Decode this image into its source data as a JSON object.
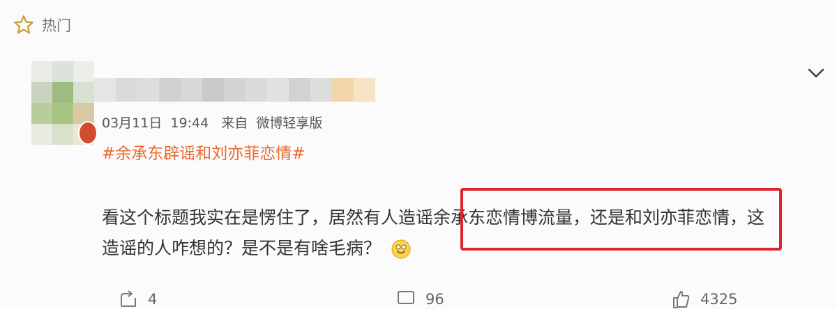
{
  "header": {
    "hot_label": "热门"
  },
  "post": {
    "meta": "03月11日  19:44   来自  微博轻享版",
    "hashtag": "#余承东辟谣和刘亦菲恋情#",
    "text_part1": "看这个标题我实在是愣住了，居然有人造谣余承东恋情博流量，还是和刘亦菲恋情，这",
    "text_part2": "造谣的人咋想的？是不是有啥毛病？"
  },
  "actions": {
    "forward_count": "4",
    "comment_count": "96",
    "like_count": "4325"
  },
  "colors": {
    "hashtag": "#e8692e",
    "highlight_border": "#e0242d",
    "star_stroke": "#c89b32"
  },
  "icons": [
    "star-icon",
    "chevron-down-icon",
    "forward-icon",
    "comment-icon",
    "like-icon",
    "smile-emoji"
  ]
}
